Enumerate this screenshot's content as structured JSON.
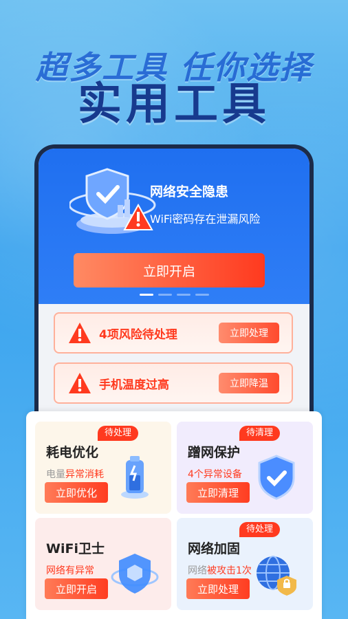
{
  "hero": {
    "subtitle": "超多工具 任你选择",
    "title": "实用工具"
  },
  "banner": {
    "title": "网络安全隐患",
    "subtitle": "WiFi密码存在泄漏风险",
    "button": "立即开启",
    "pager": {
      "count": 4,
      "active": 0
    }
  },
  "alerts": [
    {
      "text": "4项风险待处理",
      "button": "立即处理"
    },
    {
      "text": "手机温度过高",
      "button": "立即降温"
    }
  ],
  "tools": [
    {
      "name": "耗电优化",
      "tag": "待处理",
      "desc_gray": "电量",
      "desc_red": "异常消耗",
      "button": "立即优化",
      "icon": "battery-icon",
      "bg": "#fdf6ea"
    },
    {
      "name": "蹭网保护",
      "tag": "待清理",
      "desc_gray": "",
      "desc_red": "4个异常设备",
      "button": "立即清理",
      "icon": "shield-check-icon",
      "bg": "#f1ecfd"
    },
    {
      "name": "WiFi卫士",
      "tag": "",
      "desc_gray": "",
      "desc_red": "网络有异常",
      "button": "立即开启",
      "icon": "shield-cube-icon",
      "bg": "#fdeceb"
    },
    {
      "name": "网络加固",
      "tag": "待处理",
      "desc_gray": "网络",
      "desc_red": "被攻击1次",
      "button": "立即处理",
      "icon": "globe-lock-icon",
      "bg": "#eaf2fd"
    }
  ],
  "colors": {
    "accent_red": "#ff3a1f",
    "banner_blue": "#2f7ef6"
  }
}
